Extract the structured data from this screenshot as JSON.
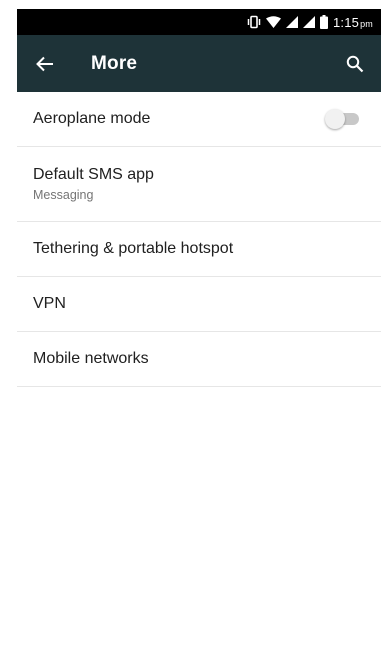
{
  "status_bar": {
    "time": "1:15",
    "ampm": "pm",
    "icons": [
      "vibrate-icon",
      "wifi-icon",
      "signal-icon",
      "signal-icon",
      "battery-icon"
    ]
  },
  "toolbar": {
    "title": "More",
    "back_icon": "arrow-left-icon",
    "search_icon": "search-icon",
    "background": "#1e3338"
  },
  "items": [
    {
      "title": "Aeroplane mode",
      "toggle": {
        "on": false
      }
    },
    {
      "title": "Default SMS app",
      "subtitle": "Messaging"
    },
    {
      "title": "Tethering & portable hotspot"
    },
    {
      "title": "VPN"
    },
    {
      "title": "Mobile networks"
    }
  ]
}
